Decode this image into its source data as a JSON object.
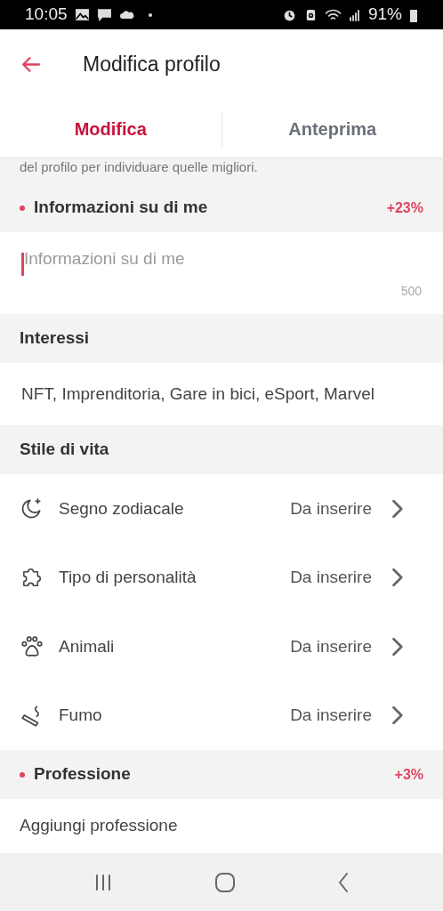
{
  "status_bar": {
    "time": "10:05",
    "battery": "91%"
  },
  "header": {
    "title": "Modifica profilo"
  },
  "tabs": [
    {
      "label": "Modifica",
      "selected": true
    },
    {
      "label": "Anteprima",
      "selected": false
    }
  ],
  "hint_text": "del profilo per individuare quelle migliori.",
  "about": {
    "title": "Informazioni su di me",
    "required": true,
    "bonus": "+23%",
    "placeholder": "Informazioni su di me",
    "counter": "500"
  },
  "interests": {
    "title": "Interessi",
    "value": "NFT, Imprenditoria, Gare in bici, eSport, Marvel"
  },
  "lifestyle": {
    "title": "Stile di vita",
    "items": [
      {
        "kind": "moon",
        "label": "Segno zodiacale",
        "value": "Da inserire"
      },
      {
        "kind": "puzzle",
        "label": "Tipo di personalità",
        "value": "Da inserire"
      },
      {
        "kind": "paw",
        "label": "Animali",
        "value": "Da inserire"
      },
      {
        "kind": "cigarette",
        "label": "Fumo",
        "value": "Da inserire"
      }
    ]
  },
  "profession": {
    "title": "Professione",
    "required": true,
    "bonus": "+3%",
    "placeholder": "Aggiungi professione"
  }
}
